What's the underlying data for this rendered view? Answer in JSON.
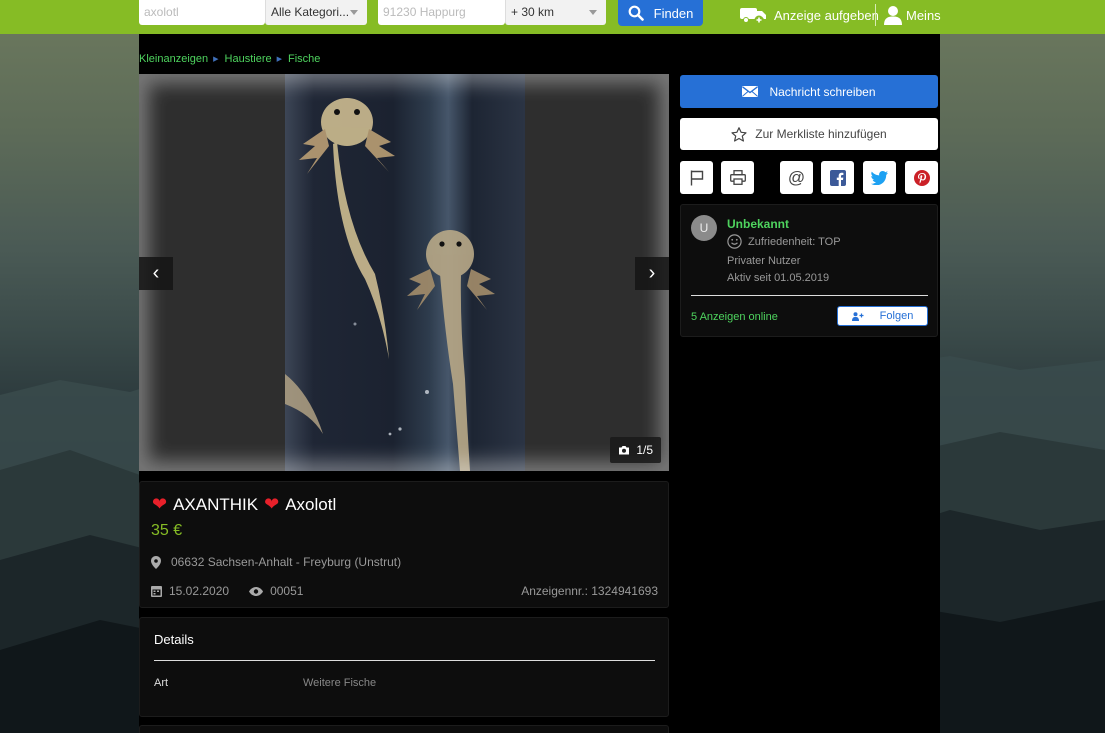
{
  "search": {
    "query": "axolotl",
    "category": "Alle Kategori...",
    "location_placeholder": "91230 Happurg",
    "radius": "+ 30 km",
    "find_label": "Finden"
  },
  "header": {
    "post_ad_label": "Anzeige aufgeben",
    "account_label": "Meins"
  },
  "breadcrumb": [
    "Kleinanzeigen",
    "Haustiere",
    "Fische"
  ],
  "gallery": {
    "counter": "1/5"
  },
  "listing": {
    "title_main": "AXANTHIK",
    "title_sub": "Axolotl",
    "price": "35 €",
    "location": "06632 Sachsen-Anhalt - Freyburg (Unstrut)",
    "date": "15.02.2020",
    "views": "00051",
    "ad_number": "Anzeigennr.: 1324941693"
  },
  "details": {
    "heading": "Details",
    "rows": [
      {
        "key": "Art",
        "value": "Weitere Fische"
      }
    ]
  },
  "actions": {
    "message_label": "Nachricht schreiben",
    "watchlist_label": "Zur Merkliste hinzufügen"
  },
  "seller": {
    "initial": "U",
    "name": "Unbekannt",
    "satisfaction": "Zufriedenheit: TOP",
    "type": "Privater Nutzer",
    "active_since": "Aktiv seit 01.05.2019",
    "ads_online": "5 Anzeigen online",
    "follow_label": "Folgen"
  },
  "colors": {
    "brand_green": "#86bc25",
    "accent_blue": "#2670d6",
    "link_green": "#4ed35e",
    "heart_red": "#e8202a"
  }
}
